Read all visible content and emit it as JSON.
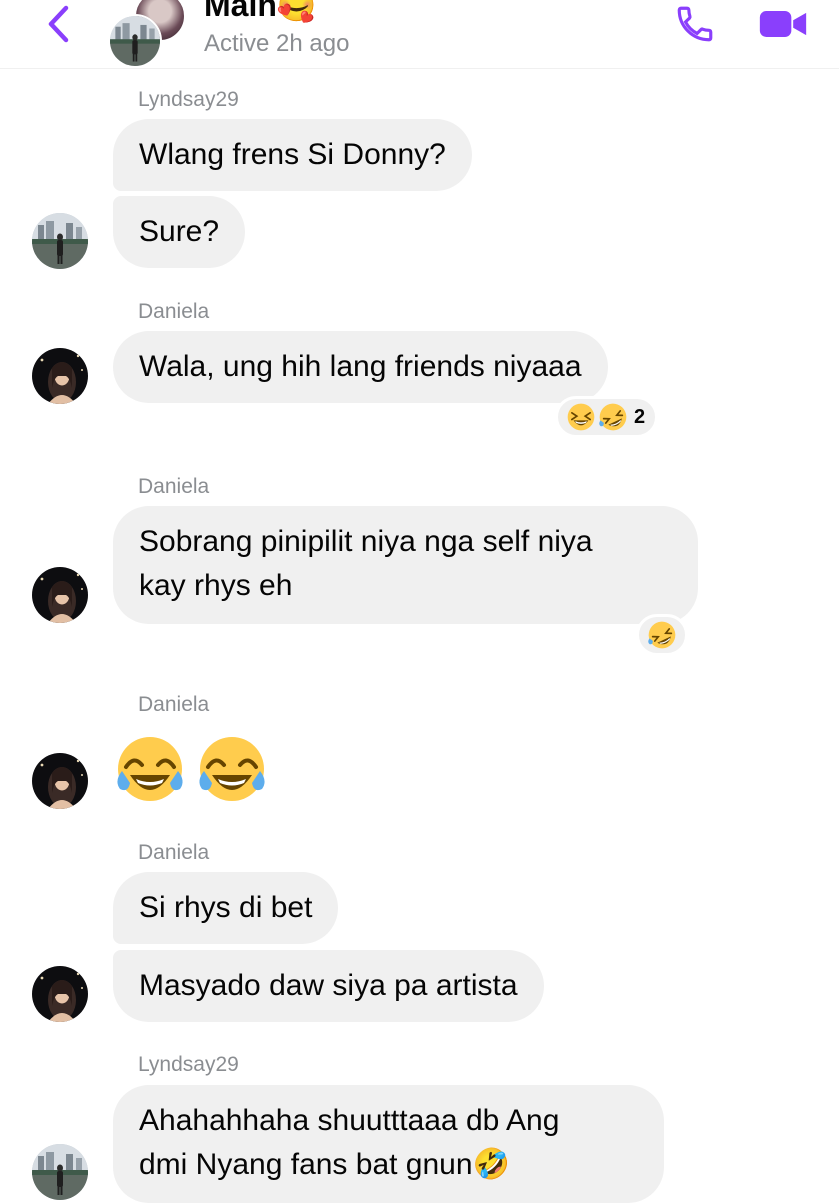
{
  "header": {
    "title": "Main🥰",
    "status": "Active 2h ago"
  },
  "colors": {
    "accent": "#8a3ffc",
    "bubble": "#f0f0f0",
    "muted": "#8a8d91"
  },
  "icons": {
    "back": "chevron-left-icon",
    "call": "phone-icon",
    "video": "video-camera-icon"
  },
  "messages": [
    {
      "sender": "Lyndsay29",
      "bubbles": [
        "Wlang frens Si Donny?",
        "Sure?"
      ]
    },
    {
      "sender": "Daniela",
      "bubbles": [
        "Wala, ung hih lang friends niyaaa"
      ],
      "reaction": {
        "emojis": [
          "laughing",
          "rolling-on-floor-laughing"
        ],
        "count": "2"
      }
    },
    {
      "sender": "Daniela",
      "bubbles": [
        "Sobrang pinipilit niya nga self niya",
        "kay rhys eh"
      ],
      "reaction": {
        "emojis": [
          "rolling-on-floor-laughing"
        ]
      }
    },
    {
      "sender": "Daniela",
      "emoji_message": [
        "tears-of-joy",
        "tears-of-joy"
      ]
    },
    {
      "sender": "Daniela",
      "bubbles": [
        "Si rhys di bet",
        "Masyado daw siya pa artista"
      ]
    },
    {
      "sender": "Lyndsay29",
      "bubbles": [
        "Ahahahhaha shuutttaaa db Ang",
        "dmi Nyang fans bat gnun🤣"
      ]
    }
  ]
}
